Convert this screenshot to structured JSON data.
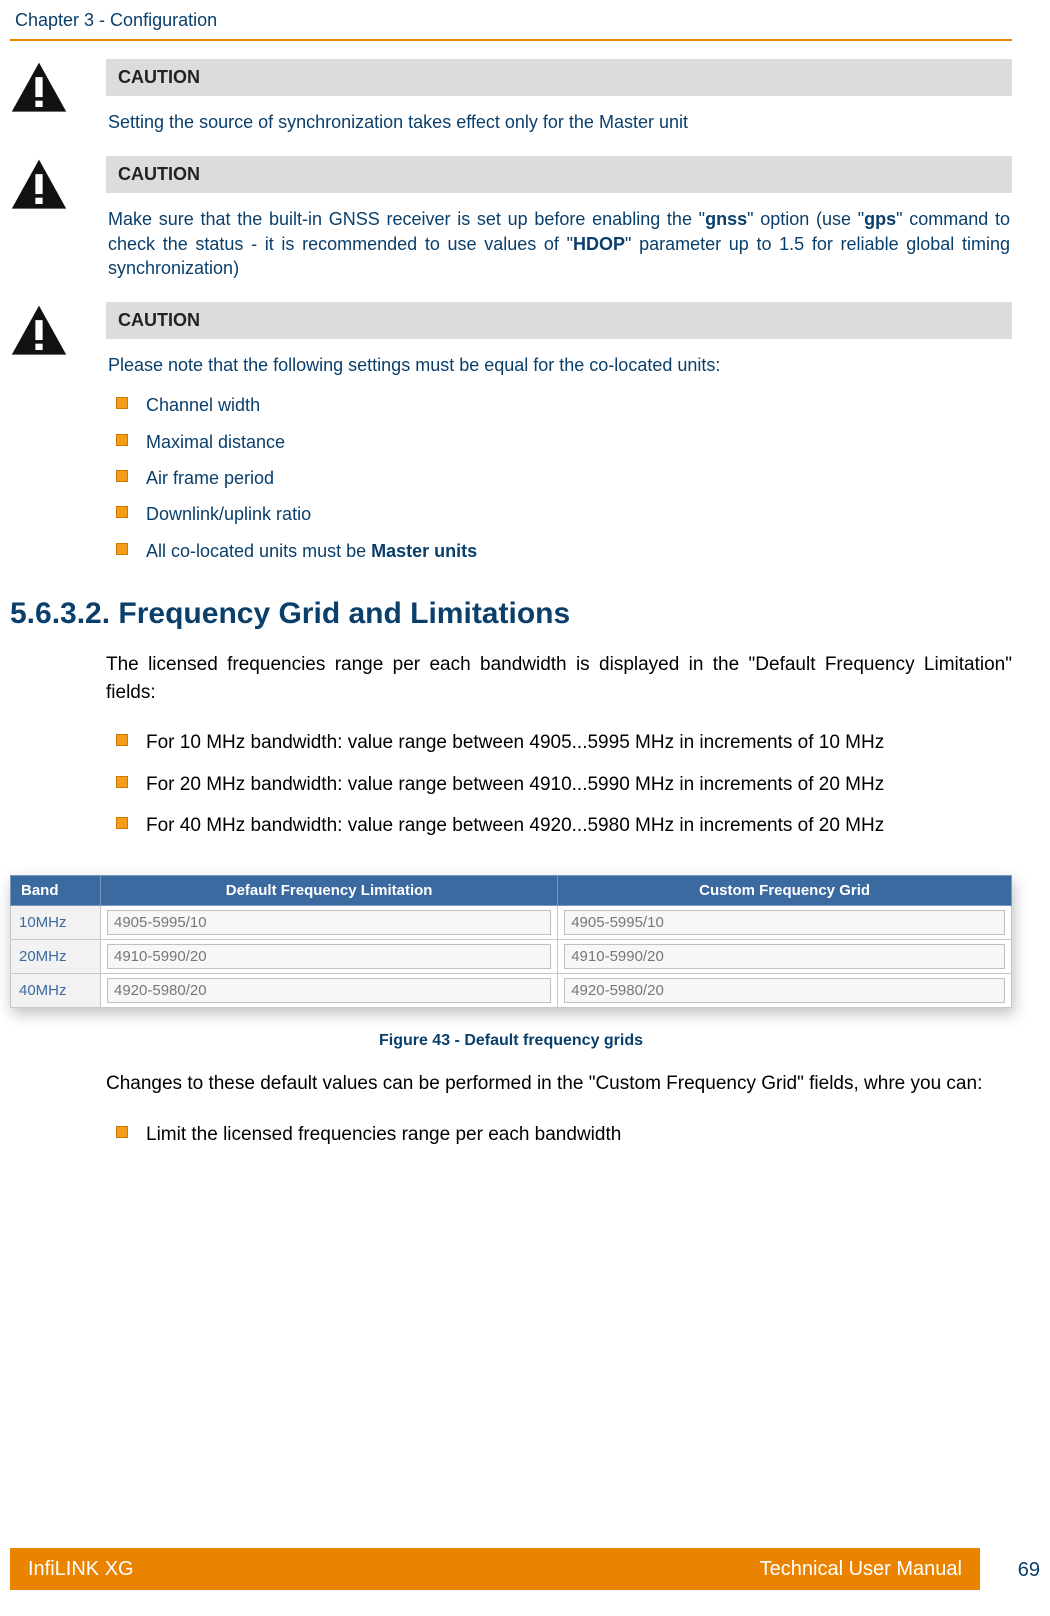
{
  "header": {
    "chapter": "Chapter 3 - Configuration"
  },
  "caution1": {
    "label": "CAUTION",
    "text": "Setting the source of synchronization takes effect only for the Master unit"
  },
  "caution2": {
    "label": "CAUTION",
    "pre": "Make sure that the built-in GNSS receiver is set up before enabling the \"",
    "b1": "gnss",
    "mid1": "\" option (use \"",
    "b2": "gps",
    "mid2": "\" command to check the status - it is recommended to use values of \"",
    "b3": "HDOP",
    "post": "\" parameter up to 1.5 for reliable global timing synchronization)"
  },
  "caution3": {
    "label": "CAUTION",
    "intro": "Please note that the following settings must be equal for the co-located units:",
    "items": {
      "i1": "Channel width",
      "i2": "Maximal distance",
      "i3": "Air frame period",
      "i4": "Downlink/uplink ratio",
      "i5pre": "All co-located units must be ",
      "i5b": "Master units"
    }
  },
  "section": {
    "num": "5.6.3.2.",
    "title": "Frequency Grid and Limitations",
    "intro": "The licensed frequencies range per each bandwidth is displayed in the \"Default Frequency Limitation\" fields:",
    "bw": {
      "l1": "For 10 MHz bandwidth: value range between 4905...5995 MHz in increments of 10 MHz",
      "l2": "For 20 MHz bandwidth: value range between 4910...5990 MHz in increments of 20 MHz",
      "l3": "For 40 MHz bandwidth: value range between 4920...5980 MHz in increments of 20 MHz"
    }
  },
  "table": {
    "headers": {
      "c1": "Band",
      "c2": "Default Frequency Limitation",
      "c3": "Custom Frequency Grid"
    },
    "rows": {
      "r1": {
        "band": "10MHz",
        "def": "4905-5995/10",
        "cust": "4905-5995/10"
      },
      "r2": {
        "band": "20MHz",
        "def": "4910-5990/20",
        "cust": "4910-5990/20"
      },
      "r3": {
        "band": "40MHz",
        "def": "4920-5980/20",
        "cust": "4920-5980/20"
      }
    }
  },
  "figure": {
    "caption": "Figure 43 - Default frequency grids"
  },
  "after": {
    "para": "Changes to these default values can be performed in the \"Custom Frequency Grid\" fields, whre you can:",
    "li1": "Limit the licensed frequencies range per each bandwidth"
  },
  "footer": {
    "left": "InfiLINK XG",
    "right": "Technical User Manual",
    "page": "69"
  }
}
